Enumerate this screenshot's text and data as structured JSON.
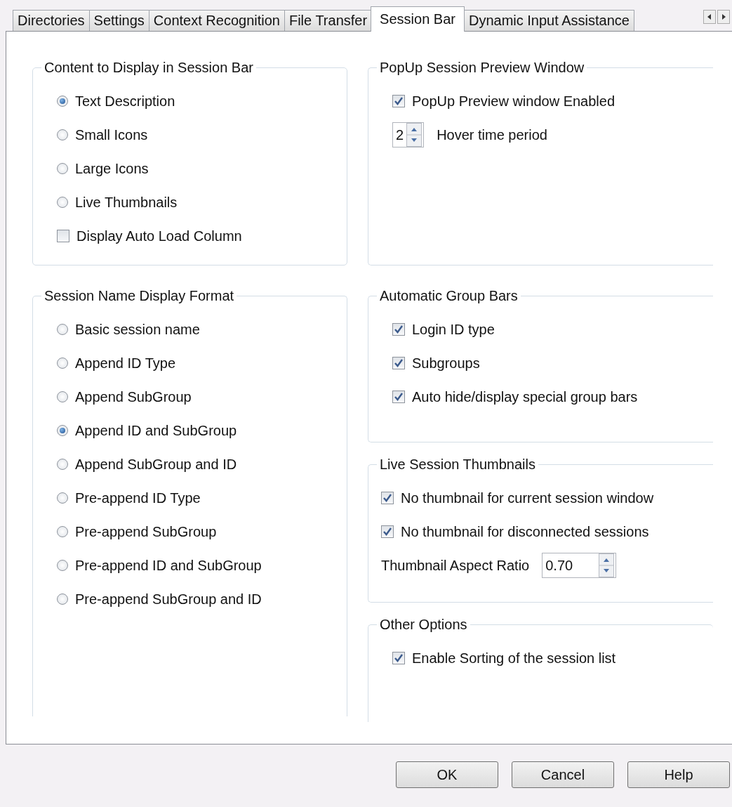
{
  "tabs": [
    {
      "label": "Directories",
      "selected": false
    },
    {
      "label": "Settings",
      "selected": false
    },
    {
      "label": "Context Recognition",
      "selected": false
    },
    {
      "label": "File Transfer",
      "selected": false
    },
    {
      "label": "Session Bar",
      "selected": true
    },
    {
      "label": "Dynamic Input Assistance",
      "selected": false
    }
  ],
  "left_groups": [
    {
      "title": "Content to Display in Session Bar",
      "items": [
        {
          "kind": "radio",
          "label": "Text Description",
          "selected": true
        },
        {
          "kind": "radio",
          "label": "Small Icons",
          "selected": false
        },
        {
          "kind": "radio",
          "label": "Large Icons",
          "selected": false
        },
        {
          "kind": "radio",
          "label": "Live Thumbnails",
          "selected": false
        },
        {
          "kind": "checkbox",
          "label": "Display Auto Load Column",
          "checked": false
        }
      ]
    },
    {
      "title": "Session Name Display Format",
      "items": [
        {
          "kind": "radio",
          "label": "Basic session name",
          "selected": false
        },
        {
          "kind": "radio",
          "label": "Append ID Type",
          "selected": false
        },
        {
          "kind": "radio",
          "label": "Append SubGroup",
          "selected": false
        },
        {
          "kind": "radio",
          "label": "Append ID and SubGroup",
          "selected": true
        },
        {
          "kind": "radio",
          "label": "Append SubGroup and ID",
          "selected": false
        },
        {
          "kind": "radio",
          "label": "Pre-append ID Type",
          "selected": false
        },
        {
          "kind": "radio",
          "label": "Pre-append SubGroup",
          "selected": false
        },
        {
          "kind": "radio",
          "label": "Pre-append ID and SubGroup",
          "selected": false
        },
        {
          "kind": "radio",
          "label": "Pre-append SubGroup and ID",
          "selected": false
        }
      ]
    }
  ],
  "right_groups": [
    {
      "title": "PopUp Session Preview Window",
      "items": [
        {
          "kind": "checkbox",
          "label": "PopUp Preview window Enabled",
          "checked": true
        },
        {
          "kind": "spinner",
          "value": "2",
          "label": "Hover time period"
        }
      ]
    },
    {
      "title": "Automatic Group Bars",
      "items": [
        {
          "kind": "checkbox",
          "label": "Login ID type",
          "checked": true
        },
        {
          "kind": "checkbox",
          "label": "Subgroups",
          "checked": true
        },
        {
          "kind": "checkbox",
          "label": "Auto hide/display special group bars",
          "checked": true
        }
      ]
    },
    {
      "title": "Live Session Thumbnails",
      "items": [
        {
          "kind": "checkbox",
          "label": "No thumbnail for current session window",
          "checked": true
        },
        {
          "kind": "checkbox",
          "label": "No thumbnail for disconnected sessions",
          "checked": true
        },
        {
          "kind": "labeled-spinner",
          "label": "Thumbnail Aspect Ratio",
          "value": "0.70"
        }
      ]
    },
    {
      "title": "Other Options",
      "items": [
        {
          "kind": "checkbox",
          "label": "Enable Sorting of the session list",
          "checked": true
        }
      ]
    }
  ],
  "buttons": [
    "OK",
    "Cancel",
    "Help"
  ]
}
